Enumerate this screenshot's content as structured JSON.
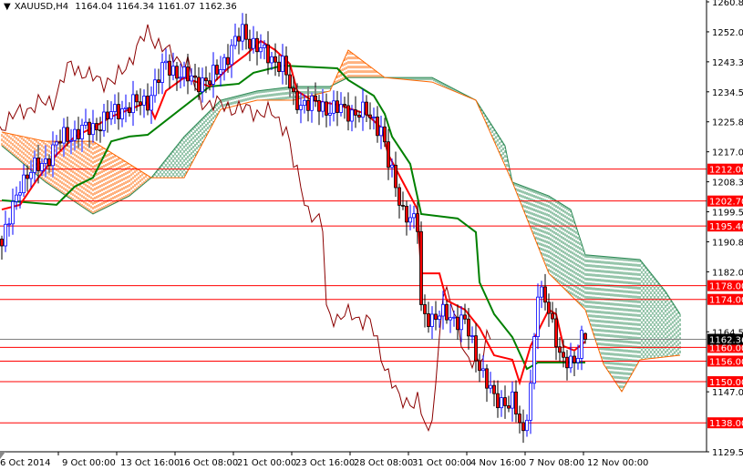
{
  "header": {
    "arrow": "▼",
    "symbol": "XAUUSD,H4",
    "open": "1164.04",
    "high": "1164.34",
    "low": "1161.07",
    "close": "1162.36"
  },
  "colors": {
    "bull": "#0000ff",
    "bear_body": "#ff0000",
    "bear_outline": "#000000",
    "tenkan": "#ff0000",
    "kijun": "#008000",
    "chikou": "#8b0000",
    "cloud_up": "#2e8b57",
    "cloud_down": "#ff6600",
    "level": "#ff0000",
    "current": "#808080"
  },
  "chart_data": {
    "type": "candlestick",
    "title": "XAUUSD,H4",
    "ylim": [
      1129.55,
      1260.8
    ],
    "x_unit": "bar index (H4)",
    "xlim": [
      0,
      194
    ],
    "y_ticks": [
      "1260.80",
      "1252.05",
      "1243.30",
      "1234.55",
      "1225.80",
      "1217.05",
      "1208.30",
      "1199.55",
      "1190.80",
      "1182.05",
      "1164.55",
      "1147.05",
      "1129.55"
    ],
    "x_ticks": [
      {
        "bar": 0,
        "label": "6 Oct 2014"
      },
      {
        "bar": 16,
        "label": "9 Oct 00:00"
      },
      {
        "bar": 32,
        "label": "13 Oct 16:00"
      },
      {
        "bar": 48,
        "label": "16 Oct 08:00"
      },
      {
        "bar": 64,
        "label": "21 Oct 00:00"
      },
      {
        "bar": 80,
        "label": "23 Oct 16:00"
      },
      {
        "bar": 96,
        "label": "28 Oct 08:00"
      },
      {
        "bar": 112,
        "label": "31 Oct 00:00"
      },
      {
        "bar": 128,
        "label": "4 Nov 16:00"
      },
      {
        "bar": 144,
        "label": "7 Nov 08:00"
      },
      {
        "bar": 160,
        "label": "12 Nov 00:00"
      }
    ],
    "price_path": [
      [
        0,
        1189.6
      ],
      [
        5,
        1208.2
      ],
      [
        12,
        1214.8
      ],
      [
        17,
        1221.5
      ],
      [
        25,
        1224.1
      ],
      [
        32,
        1229.4
      ],
      [
        40,
        1232.1
      ],
      [
        45,
        1242.7
      ],
      [
        50,
        1238.7
      ],
      [
        57,
        1237.4
      ],
      [
        62,
        1245.4
      ],
      [
        66,
        1252.0
      ],
      [
        72,
        1245.4
      ],
      [
        77,
        1242.7
      ],
      [
        80,
        1232.1
      ],
      [
        85,
        1230.8
      ],
      [
        92,
        1229.4
      ],
      [
        100,
        1228.1
      ],
      [
        104,
        1224.1
      ],
      [
        106,
        1213.5
      ],
      [
        110,
        1200.2
      ],
      [
        114,
        1194.9
      ],
      [
        115,
        1171.0
      ],
      [
        118,
        1168.3
      ],
      [
        122,
        1169.7
      ],
      [
        127,
        1167.0
      ],
      [
        131,
        1155.1
      ],
      [
        135,
        1144.4
      ],
      [
        140,
        1144.4
      ],
      [
        143,
        1133.8
      ],
      [
        145,
        1149.7
      ],
      [
        147,
        1176.3
      ],
      [
        150,
        1171.0
      ],
      [
        154,
        1155.1
      ],
      [
        157,
        1155.1
      ],
      [
        159,
        1164.04
      ],
      [
        160,
        1162.36
      ]
    ],
    "tenkan": [
      [
        0,
        1200.2
      ],
      [
        5,
        1201.6
      ],
      [
        10,
        1209.5
      ],
      [
        15,
        1216.2
      ],
      [
        20,
        1221.5
      ],
      [
        25,
        1224.1
      ],
      [
        30,
        1227.3
      ],
      [
        35,
        1229.4
      ],
      [
        40,
        1231.6
      ],
      [
        42,
        1226.8
      ],
      [
        45,
        1234.8
      ],
      [
        50,
        1238.7
      ],
      [
        57,
        1236.1
      ],
      [
        62,
        1241.4
      ],
      [
        67,
        1245.4
      ],
      [
        71,
        1249.4
      ],
      [
        75,
        1246.7
      ],
      [
        79,
        1242.7
      ],
      [
        81,
        1234.8
      ],
      [
        85,
        1232.1
      ],
      [
        92,
        1230.8
      ],
      [
        100,
        1228.1
      ],
      [
        104,
        1224.1
      ],
      [
        106,
        1216.2
      ],
      [
        110,
        1208.2
      ],
      [
        114,
        1200.2
      ],
      [
        115,
        1181.6
      ],
      [
        120,
        1181.6
      ],
      [
        122,
        1173.7
      ],
      [
        127,
        1171.0
      ],
      [
        131,
        1165.7
      ],
      [
        135,
        1157.7
      ],
      [
        140,
        1156.4
      ],
      [
        142,
        1149.7
      ],
      [
        145,
        1160.4
      ],
      [
        150,
        1171.0
      ],
      [
        152,
        1169.7
      ],
      [
        154,
        1160.4
      ],
      [
        157,
        1159.1
      ],
      [
        160,
        1161.7
      ]
    ],
    "kijun": [
      [
        0,
        1202.9
      ],
      [
        15,
        1201.6
      ],
      [
        20,
        1206.9
      ],
      [
        25,
        1209.5
      ],
      [
        30,
        1220.1
      ],
      [
        35,
        1221.5
      ],
      [
        40,
        1222.0
      ],
      [
        57,
        1236.1
      ],
      [
        65,
        1236.9
      ],
      [
        69,
        1240.1
      ],
      [
        77,
        1242.2
      ],
      [
        92,
        1241.4
      ],
      [
        95,
        1238.0
      ],
      [
        102,
        1233.4
      ],
      [
        105,
        1228.1
      ],
      [
        107,
        1221.5
      ],
      [
        112,
        1213.5
      ],
      [
        115,
        1198.9
      ],
      [
        125,
        1197.6
      ],
      [
        130,
        1193.6
      ],
      [
        131,
        1179.0
      ],
      [
        135,
        1169.7
      ],
      [
        140,
        1163.0
      ],
      [
        144,
        1153.7
      ],
      [
        147,
        1155.6
      ],
      [
        160,
        1155.6
      ]
    ],
    "span_a": [
      [
        0,
        1218.8
      ],
      [
        12,
        1208.2
      ],
      [
        25,
        1198.9
      ],
      [
        35,
        1204.2
      ],
      [
        41,
        1209.5
      ],
      [
        50,
        1221.5
      ],
      [
        60,
        1232.1
      ],
      [
        70,
        1234.8
      ],
      [
        80,
        1236.1
      ],
      [
        90,
        1236.1
      ],
      [
        95,
        1238.7
      ],
      [
        105,
        1238.7
      ],
      [
        118,
        1238.7
      ],
      [
        130,
        1232.1
      ],
      [
        138,
        1218.8
      ],
      [
        140,
        1208.2
      ],
      [
        150,
        1204.2
      ],
      [
        156,
        1200.2
      ],
      [
        160,
        1187.0
      ],
      [
        175,
        1185.6
      ],
      [
        182,
        1176.3
      ],
      [
        186,
        1169.7
      ]
    ],
    "span_b": [
      [
        0,
        1222.8
      ],
      [
        12,
        1220.1
      ],
      [
        25,
        1220.1
      ],
      [
        41,
        1209.5
      ],
      [
        50,
        1209.5
      ],
      [
        60,
        1229.4
      ],
      [
        70,
        1232.1
      ],
      [
        80,
        1232.1
      ],
      [
        90,
        1234.8
      ],
      [
        95,
        1246.7
      ],
      [
        105,
        1238.7
      ],
      [
        118,
        1237.4
      ],
      [
        130,
        1232.1
      ],
      [
        140,
        1208.2
      ],
      [
        150,
        1181.6
      ],
      [
        160,
        1171.0
      ],
      [
        165,
        1155.1
      ],
      [
        170,
        1147.1
      ],
      [
        175,
        1156.4
      ],
      [
        186,
        1157.7
      ]
    ],
    "chikou_shift": 26,
    "levels": [
      "1212.00",
      "1202.70",
      "1195.40",
      "1178.00",
      "1174.00",
      "1160.00",
      "1156.00",
      "1150.00",
      "1138.00"
    ],
    "current_price": "1162.36"
  }
}
